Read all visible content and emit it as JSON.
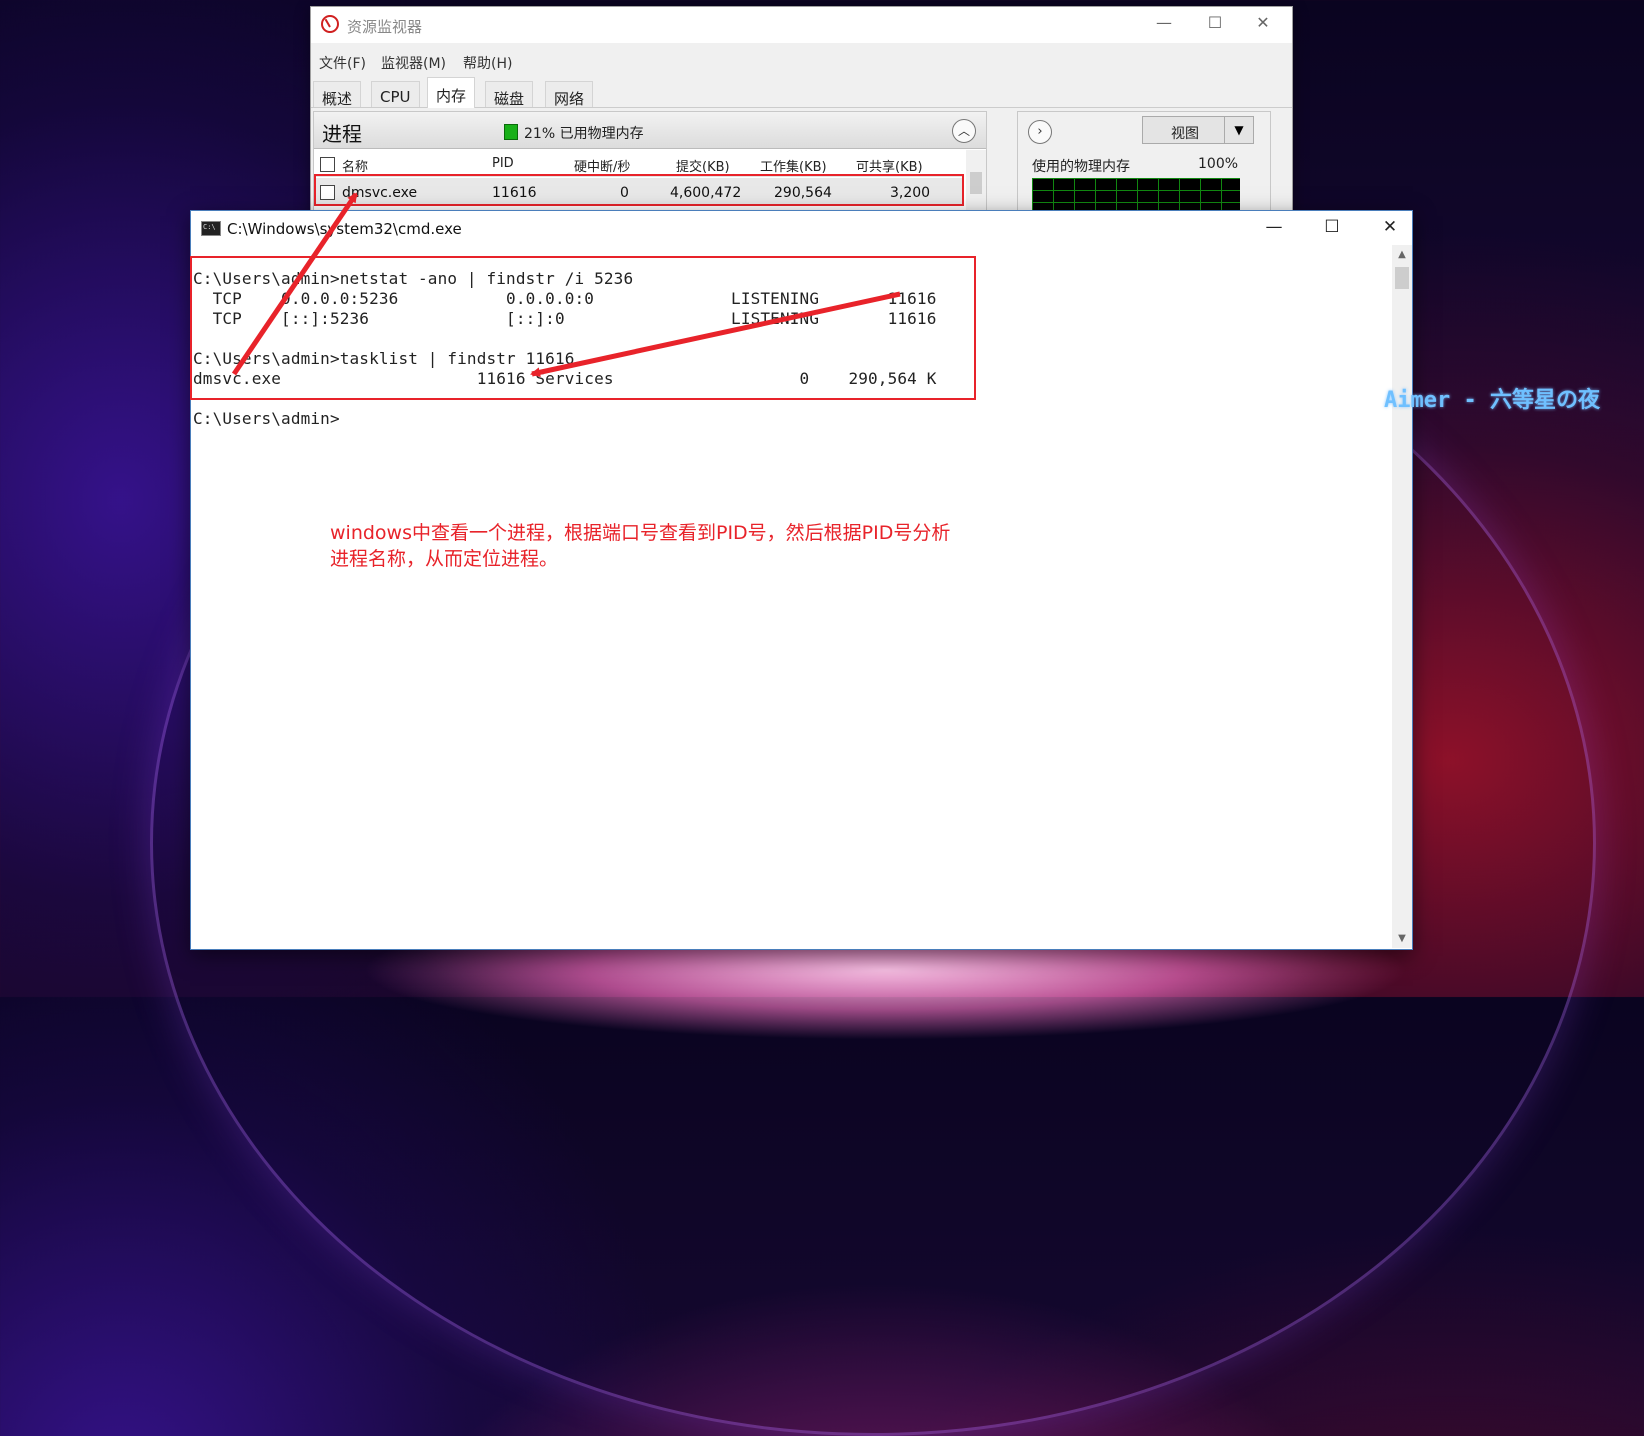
{
  "resource_monitor": {
    "title": "资源监视器",
    "menu": [
      "文件(F)",
      "监视器(M)",
      "帮助(H)"
    ],
    "tabs": [
      "概述",
      "CPU",
      "内存",
      "磁盘",
      "网络"
    ],
    "active_tab": "内存",
    "section_title": "进程",
    "memory_summary": "21% 已用物理内存",
    "columns": [
      "名称",
      "PID",
      "硬中断/秒",
      "提交(KB)",
      "工作集(KB)",
      "可共享(KB)"
    ],
    "row": {
      "name": "dmsvc.exe",
      "pid": "11616",
      "hard_faults": "0",
      "commit": "4,600,472",
      "working_set": "290,564",
      "shareable": "3,200"
    },
    "view_button": "视图",
    "graph_label": "使用的物理内存",
    "graph_percent": "100%",
    "controls": {
      "minimize": "—",
      "maximize": "☐",
      "close": "✕"
    }
  },
  "cmd": {
    "title": "C:\\Windows\\system32\\cmd.exe",
    "lines": [
      "C:\\Users\\admin>netstat -ano | findstr /i 5236",
      "  TCP    0.0.0.0:5236           0.0.0.0:0              LISTENING       11616",
      "  TCP    [::]:5236              [::]:0                 LISTENING       11616",
      "",
      "C:\\Users\\admin>tasklist | findstr 11616",
      "dmsvc.exe                    11616 Services                   0    290,564 K",
      "",
      "C:\\Users\\admin>"
    ],
    "controls": {
      "minimize": "—",
      "maximize": "☐",
      "close": "✕"
    }
  },
  "annotation": {
    "line1": "windows中查看一个进程，根据端口号查看到PID号，然后根据PID号分析",
    "line2": "进程名称，从而定位进程。",
    "color": "#e8232a"
  },
  "watermark": "Aimer - 六等星の夜"
}
